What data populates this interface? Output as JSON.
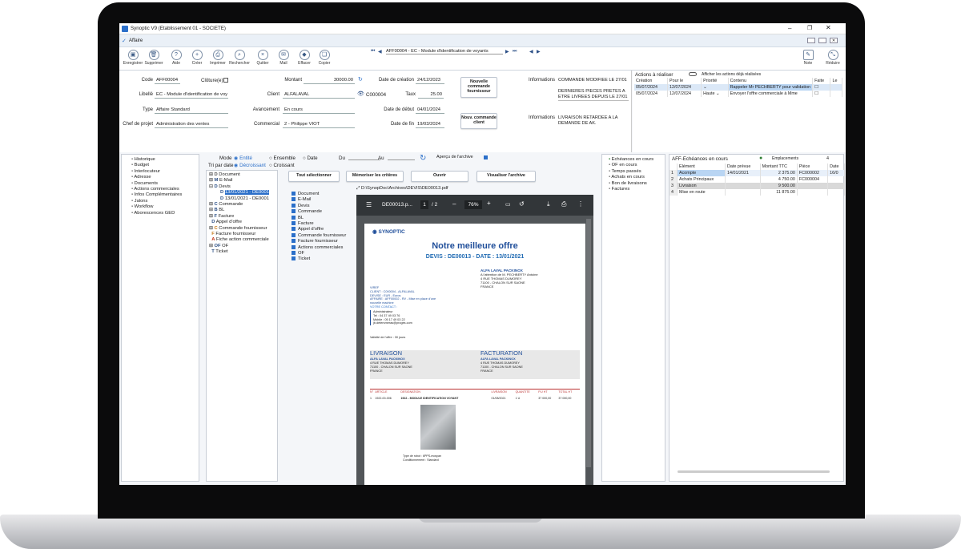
{
  "window": {
    "title": "Synoptic V9 (Etablissement 01 - SOCIETE)",
    "tab": "Affaire"
  },
  "toolbar": {
    "buttons": [
      "Enregistrer",
      "Supprimer",
      "Aide",
      "Créer",
      "Imprimer",
      "Rechercher",
      "Quitter",
      "Mail",
      "Effacer",
      "Copier"
    ],
    "right": [
      "Note",
      "Réduire"
    ]
  },
  "nav": {
    "record": "AFF00004 - EC - Module d'identification de voyants"
  },
  "form": {
    "code_label": "Code",
    "code": "AFF00004",
    "cloture_label": "Clôture(e)",
    "libelle_label": "Libellé",
    "libelle": "EC - Module d'identification de voy",
    "type_label": "Type",
    "type": "Affaire Standard",
    "chef_label": "Chef de projet",
    "chef": "Administration des ventes",
    "montant_label": "Montant",
    "montant": "30000.00",
    "client_label": "Client",
    "client": "ALFALAVAL",
    "client_code": "C000004",
    "taux_label": "Taux",
    "taux": "25.00",
    "avancement_label": "Avancement",
    "avancement": "En cours",
    "commercial_label": "Commercial",
    "commercial": "2 - Philippe VIOT",
    "date_creation_label": "Date de création",
    "date_creation": "24/12/2023",
    "date_debut_label": "Date de début",
    "date_debut": "04/01/2024",
    "date_fin_label": "Date de fin",
    "date_fin": "19/03/2024",
    "btn_nouvelle_commande": "Nouvelle commande fournisseur",
    "btn_nouv_client": "Nouv. commande client",
    "informations_label": "Informations",
    "info1": "COMMANDE MODIFIEE LE 27/01",
    "info2": "DERNIERES PIECES PRETES A ETRE LIVREES DEPUIS LE 27/01",
    "info3": "LIVRAISON RETARDEE A LA DEMANDE DE AK."
  },
  "actions": {
    "title": "Actions à réaliser",
    "toggle": "Afficher les actions déjà réalisées",
    "headers": [
      "Création",
      "Pour le",
      "Priorité",
      "Contenu",
      "Faite",
      "Le"
    ],
    "rows": [
      {
        "creation": "05/07/2024",
        "pour": "12/07/2024",
        "priorite": "",
        "contenu": "Rappeler Mr PECHBERTY pour validation"
      },
      {
        "creation": "05/07/2024",
        "pour": "12/07/2024",
        "priorite": "Haute",
        "contenu": "Envoyer l'offre commerciale à Mme"
      }
    ]
  },
  "left_tree": [
    "Historique",
    "Budget",
    "Interlocuteur",
    "Adresse",
    "Documents",
    "Actions commerciales",
    "Infos Complémentaires",
    "Jalons",
    "Workflow",
    "Aborescences GED"
  ],
  "filters": {
    "mode": "Mode",
    "entite": "Entité",
    "ensemble": "Ensemble",
    "date": "Date",
    "du": "Du",
    "au": "Au",
    "apercu": "Aperçu de l'archive",
    "tri": "Tri par date",
    "decroissant": "Décroissant",
    "croissant": "Croissant"
  },
  "doc_tree": [
    "Document",
    "E-Mail",
    "Devis",
    "13/01/2021 - DE0001",
    "13/01/2021 - DE0001",
    "Commande",
    "BL",
    "Facture",
    "Appel d'offre",
    "Commande fournisseur",
    "Facture fournisseur",
    "Fiche action commerciale",
    "OF",
    "Ticket"
  ],
  "doc_buttons": [
    "Tout sélectionner",
    "Mémoriser les critères",
    "Ouvrir",
    "Visualiser l'archive"
  ],
  "doc_types": [
    "Document",
    "E-Mail",
    "Devis",
    "Commande",
    "BL",
    "Facture",
    "Appel d'offre",
    "Commande fournisseur",
    "Facture fournisseur",
    "Actions commerciales",
    "OF",
    "Ticket"
  ],
  "pdf": {
    "path": "D:\\SynopDoc\\Archives\\DEVIS\\DE00013.pdf",
    "name": "DE00013.p...",
    "page": "1",
    "pages": "/ 2",
    "zoom": "76%",
    "logo": "SYNOPTIC",
    "heading": "Notre meilleure offre",
    "sub": "DEVIS : DE00013 - DATE : 13/01/2021",
    "client_block": [
      "ALFA LAVAL PACKINOX",
      "A l'attention de M. PECHBERTY Antoine",
      "4 RUE THOMAS DUMOREY",
      "71100 - CHALON SUR SAONE",
      "FRANCE"
    ],
    "info_block": [
      "VIREF",
      "CLIENT : C000004 - ALFALAVAL",
      "DEVISE : EUR - Euros",
      "AFFAIRE : AFF00002 - RV - Mise en place d'une",
      "nouvelle machine",
      "VOTRE CONTACT :"
    ],
    "contact_block": [
      "Administrateur",
      "Tel : 04 37 49 03 76",
      "Mobile : 05 17 49 03 22",
      "jb.detersmeras@proges.com"
    ],
    "validite": "Validité de l'offre : 30 jours",
    "livraison": "LIVRAISON",
    "facturation": "FACTURATION",
    "liv_lines": [
      "ALFA LAVAL PACKINOX",
      "4 RUE THOMAS DUMOREY",
      "71100 - CHALON SUR SAONE",
      "FRANCE"
    ],
    "fac_lines": [
      "ALFA LAVAL PACKINOX",
      "4 RUE THOMAS DUMOREY",
      "71100 - CHALON SUR SAONE",
      "FRANCE"
    ],
    "table_headers": [
      "N°",
      "ARTICLE",
      "DESIGNATION",
      "LIVRAISON",
      "QUANTITE",
      "P.U HT",
      "TOTAL HT"
    ],
    "row": [
      "1",
      "1922-00-006",
      "1922 - MODULE IDENTIFICATION VOYANT",
      "01/08/2021",
      "1 U",
      "37 000,00",
      "37 000,00"
    ],
    "caption": [
      "Type de robot : 6PPS-mosyan",
      "Conditionnement : Standard"
    ]
  },
  "right_tree": [
    "Echéances en cours",
    "OF en cours",
    "Temps passés",
    "Achats en cours",
    "Bon de livraisons",
    "Factures"
  ],
  "echeances": {
    "title": "AFF-Echéances en cours",
    "emplacements_label": "Emplacements",
    "emplacements": "4",
    "headers": [
      "Elément",
      "Date prévue",
      "Montant TTC",
      "Pièce",
      "Date"
    ],
    "rows": [
      {
        "n": "1",
        "el": "Acompte",
        "date": "14/01/2021",
        "mt": "2 375.00",
        "piece": "FC000002",
        "d": "16/0"
      },
      {
        "n": "2",
        "el": "Achats Principaux",
        "date": "",
        "mt": "4 750.00",
        "piece": "FC000004",
        "d": ""
      },
      {
        "n": "3",
        "el": "Livraison",
        "date": "",
        "mt": "9 500.00",
        "piece": "",
        "d": ""
      },
      {
        "n": "4",
        "el": "Mise en route",
        "date": "",
        "mt": "11 875.00",
        "piece": "",
        "d": ""
      }
    ]
  },
  "colors": {
    "selection": "#b9d5f3",
    "accent": "#2b6fc9",
    "pdfbar": "#323639",
    "synoptic": "#1f4e9a"
  }
}
